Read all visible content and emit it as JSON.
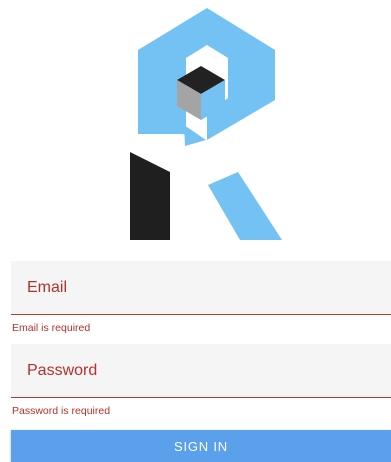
{
  "form": {
    "email": {
      "placeholder": "Email",
      "value": "",
      "error": "Email is required"
    },
    "password": {
      "placeholder": "Password",
      "value": "",
      "error": "Password is required"
    },
    "submit_label": "SIGN IN"
  },
  "logo": {
    "icon": "r-cube-logo-icon"
  },
  "colors": {
    "logo_blue": "#73c2f3",
    "logo_dark": "#1f1f1f",
    "logo_gray": "#9e9e9e",
    "error_red": "#b5302a",
    "button_blue": "#5ba0ea",
    "field_bg": "#f5f5f5"
  }
}
